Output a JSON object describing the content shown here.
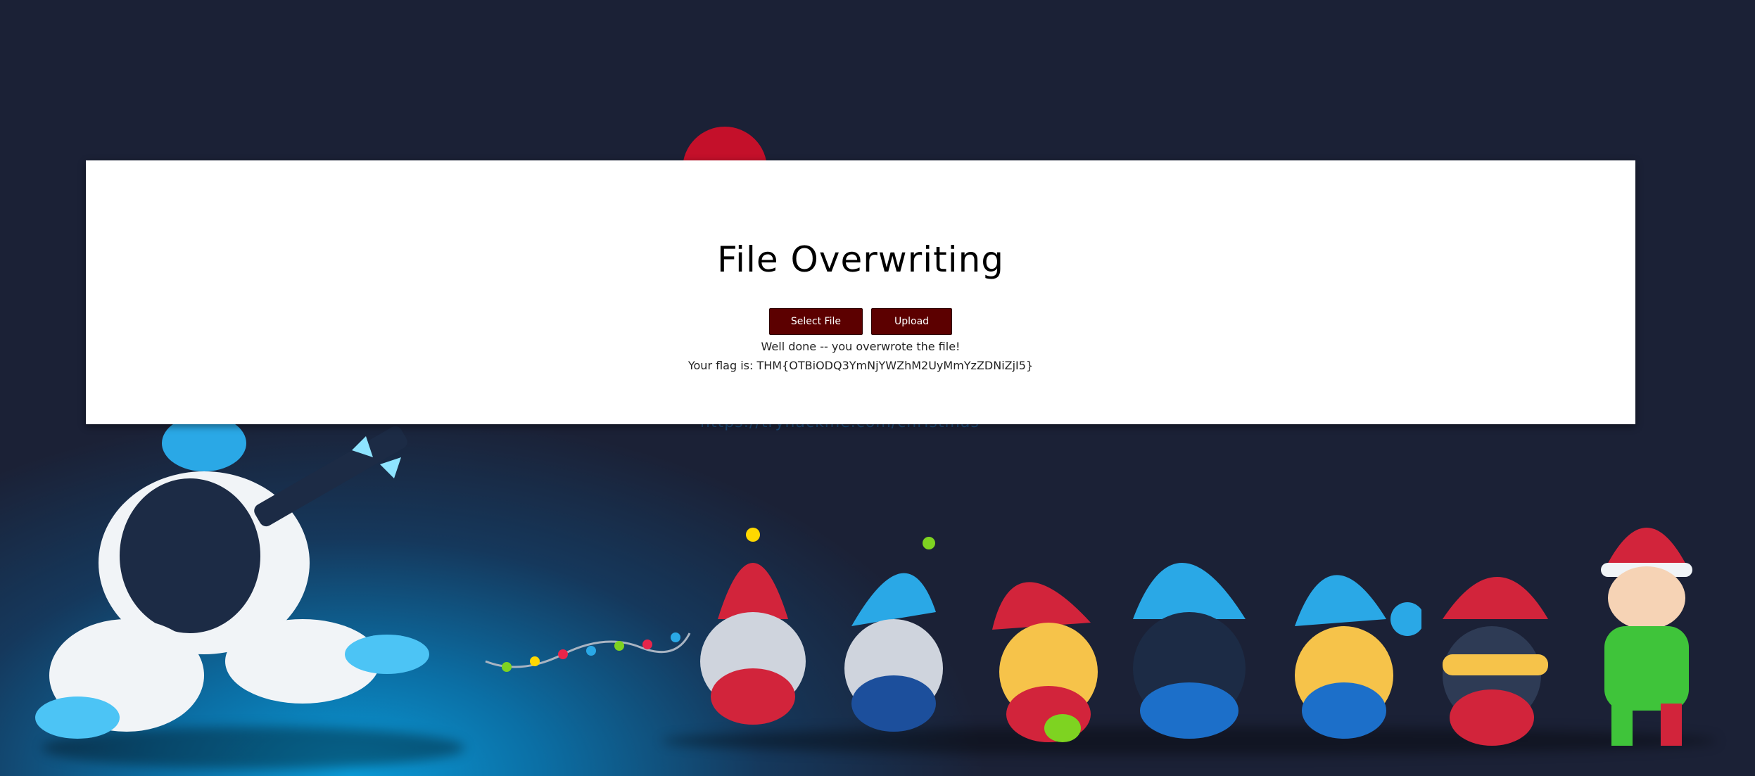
{
  "page": {
    "title": "File Overwriting",
    "buttons": {
      "select_file": "Select File",
      "upload": "Upload"
    },
    "messages": {
      "success": "Well done -- you overwrote the file!",
      "flag": "Your flag is: THM{OTBiODQ3YmNjYWZhM2UyMmYzZDNiZjI5}"
    }
  },
  "background": {
    "link_text": "https://tryhackme.com/christmas"
  },
  "colors": {
    "button_bg": "#5c0000",
    "card_bg": "#ffffff",
    "page_bg": "#1b2136",
    "glow": "#0a9bd8"
  },
  "icons": [
    "yeti-illustration",
    "gnome-illustration",
    "elf-illustration",
    "string-lights-illustration"
  ]
}
